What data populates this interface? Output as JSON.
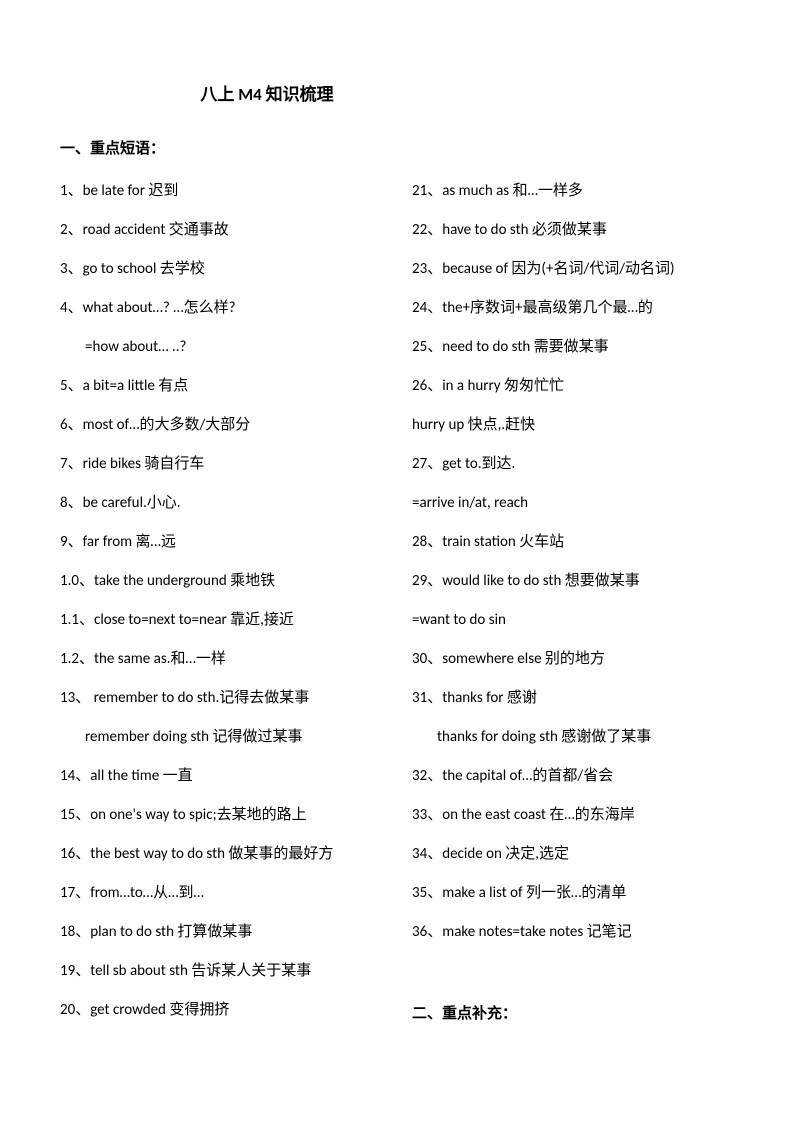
{
  "title": "八上 M4 知识梳理",
  "section1_header": "一、重点短语：",
  "section2_header": "二、重点补充：",
  "left_column": [
    {
      "text": "1、be late for 迟到",
      "sub": false
    },
    {
      "text": "2、road accident  交通事故",
      "sub": false
    },
    {
      "text": "3、go to school  去学校",
      "sub": false
    },
    {
      "text": "4、what about…?  …怎么样?",
      "sub": false
    },
    {
      "text": "=how about… ..?",
      "sub": true
    },
    {
      "text": "5、a bit=a little 有点",
      "sub": false
    },
    {
      "text": "6、most of…的大多数/大部分",
      "sub": false
    },
    {
      "text": "7、ride bikes 骑自行车",
      "sub": false
    },
    {
      "text": "8、be careful.小心.",
      "sub": false
    },
    {
      "text": "9、far from  离…远",
      "sub": false
    },
    {
      "text": "1.0、take the underground 乘地铁",
      "sub": false
    },
    {
      "text": "1.1、close to=next to=near 靠近,接近",
      "sub": false
    },
    {
      "text": "1.2、the same as.和…一样",
      "sub": false
    },
    {
      "text": "13、 remember  to  do  sth.记得去做某事",
      "sub": false
    },
    {
      "text": "remember doing sth  记得做过某事",
      "sub": true
    },
    {
      "text": "14、all the time 一直",
      "sub": false
    },
    {
      "text": "15、on one's way to spic;去某地的路上",
      "sub": false
    },
    {
      "text": "16、the best way to do sth 做某事的最好方",
      "sub": false
    },
    {
      "text": "17、from…to…从…到…",
      "sub": false
    },
    {
      "text": "18、plan to do sth 打算做某事",
      "sub": false
    },
    {
      "text": "19、tell sb about sth 告诉某人关于某事",
      "sub": false
    },
    {
      "text": "20、get crowded  变得拥挤",
      "sub": false
    }
  ],
  "right_column": [
    {
      "text": "21、as much as 和…一样多",
      "sub": false
    },
    {
      "text": "22、have to do sth 必须做某事",
      "sub": false
    },
    {
      "text": "23、because of 因为(+名词/代词/动名词)",
      "sub": false
    },
    {
      "text": "24、the+序数词+最高级第几个最…的",
      "sub": false
    },
    {
      "text": "25、need to do sth 需要做某事",
      "sub": false
    },
    {
      "text": "26、in a hurry  匆匆忙忙",
      "sub": false
    },
    {
      "text": "hurry up  快点,.赶快",
      "sub": false
    },
    {
      "text": "27、get to.到达.",
      "sub": false
    },
    {
      "text": "=arrive in/at, reach",
      "sub": false
    },
    {
      "text": "28、train station  火车站",
      "sub": false
    },
    {
      "text": "29、would like to do sth 想要做某事",
      "sub": false
    },
    {
      "text": "=want to do sin",
      "sub": false
    },
    {
      "text": "30、somewhere else  别的地方",
      "sub": false
    },
    {
      "text": "31、thanks for  感谢",
      "sub": false
    },
    {
      "text": "thanks for doing sth 感谢做了某事",
      "sub": true
    },
    {
      "text": "32、the capital of…的首都/省会",
      "sub": false
    },
    {
      "text": "33、on the east coast  在…的东海岸",
      "sub": false
    },
    {
      "text": "34、decide on 决定,选定",
      "sub": false
    },
    {
      "text": "35、make a list of  列一张…的清单",
      "sub": false
    },
    {
      "text": "36、make notes=take notes 记笔记",
      "sub": false
    }
  ]
}
